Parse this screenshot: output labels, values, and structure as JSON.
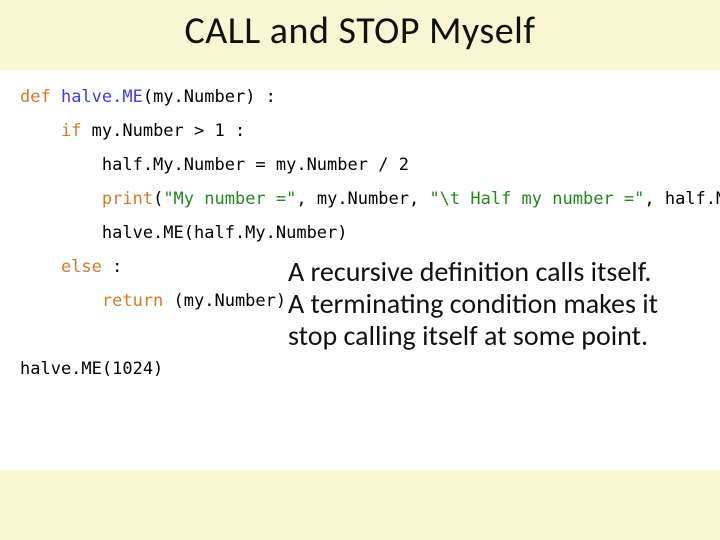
{
  "title": "CALL and STOP Myself",
  "code": {
    "l1a": "def ",
    "l1b": "halve.ME",
    "l1c": "(my.Number) :",
    "l2a": "    if",
    "l2b": " my.Number > 1 :",
    "l3": "        half.My.Number = my.Number / 2",
    "l4a": "        print",
    "l4b": "(",
    "l4c": "\"My number =\"",
    "l4d": ", my.Number, ",
    "l4e": "\"\\t Half my number =\"",
    "l4f": ", half.My.Number)",
    "l5": "        halve.ME(half.My.Number)",
    "l6a": "    else",
    "l6b": " :",
    "l7a": "        return",
    "l7b": " (my.Number)",
    "l8": "halve.ME(1024)"
  },
  "explain": {
    "p1": "A recursive definition calls itself.",
    "p2": "A terminating condition makes it stop calling itself at some point."
  }
}
